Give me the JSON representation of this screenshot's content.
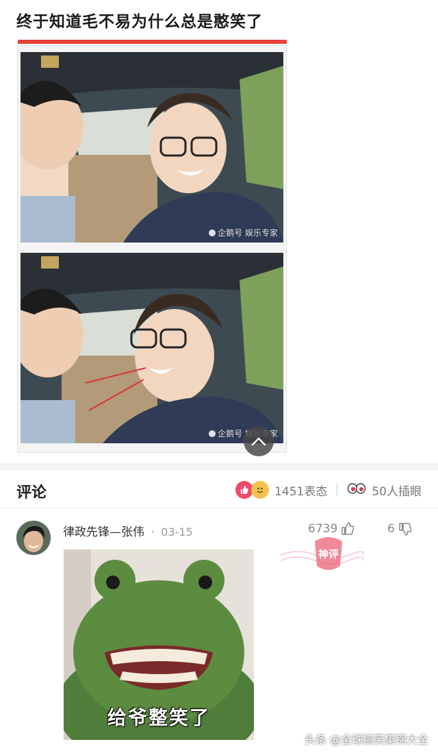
{
  "post": {
    "title": "终于知道毛不易为什么总是憨笑了",
    "photos": [
      {
        "watermark": "企鹅号 娱乐专家"
      },
      {
        "watermark": "企鹅号 娱乐专家"
      }
    ],
    "accent_color": "#e8413a"
  },
  "comments_section": {
    "title": "评论",
    "reactions_label": "1451表态",
    "eyes_label": "50人插眼"
  },
  "comment": {
    "author": "律政先锋—张伟",
    "date": "03-15",
    "likes": "6739",
    "dislikes": "6",
    "stamp_text": "神评",
    "image_caption": "给爷整笑了"
  },
  "page_watermark": "头条 @全球搞笑集锦大全",
  "icons": {
    "scroll_top": "chevron-up-icon",
    "like": "thumb-up-icon",
    "dislike": "thumb-down-icon",
    "reaction_like": "reaction-like-icon",
    "reaction_emoji": "reaction-emoji-icon",
    "eyes": "eyes-icon"
  }
}
